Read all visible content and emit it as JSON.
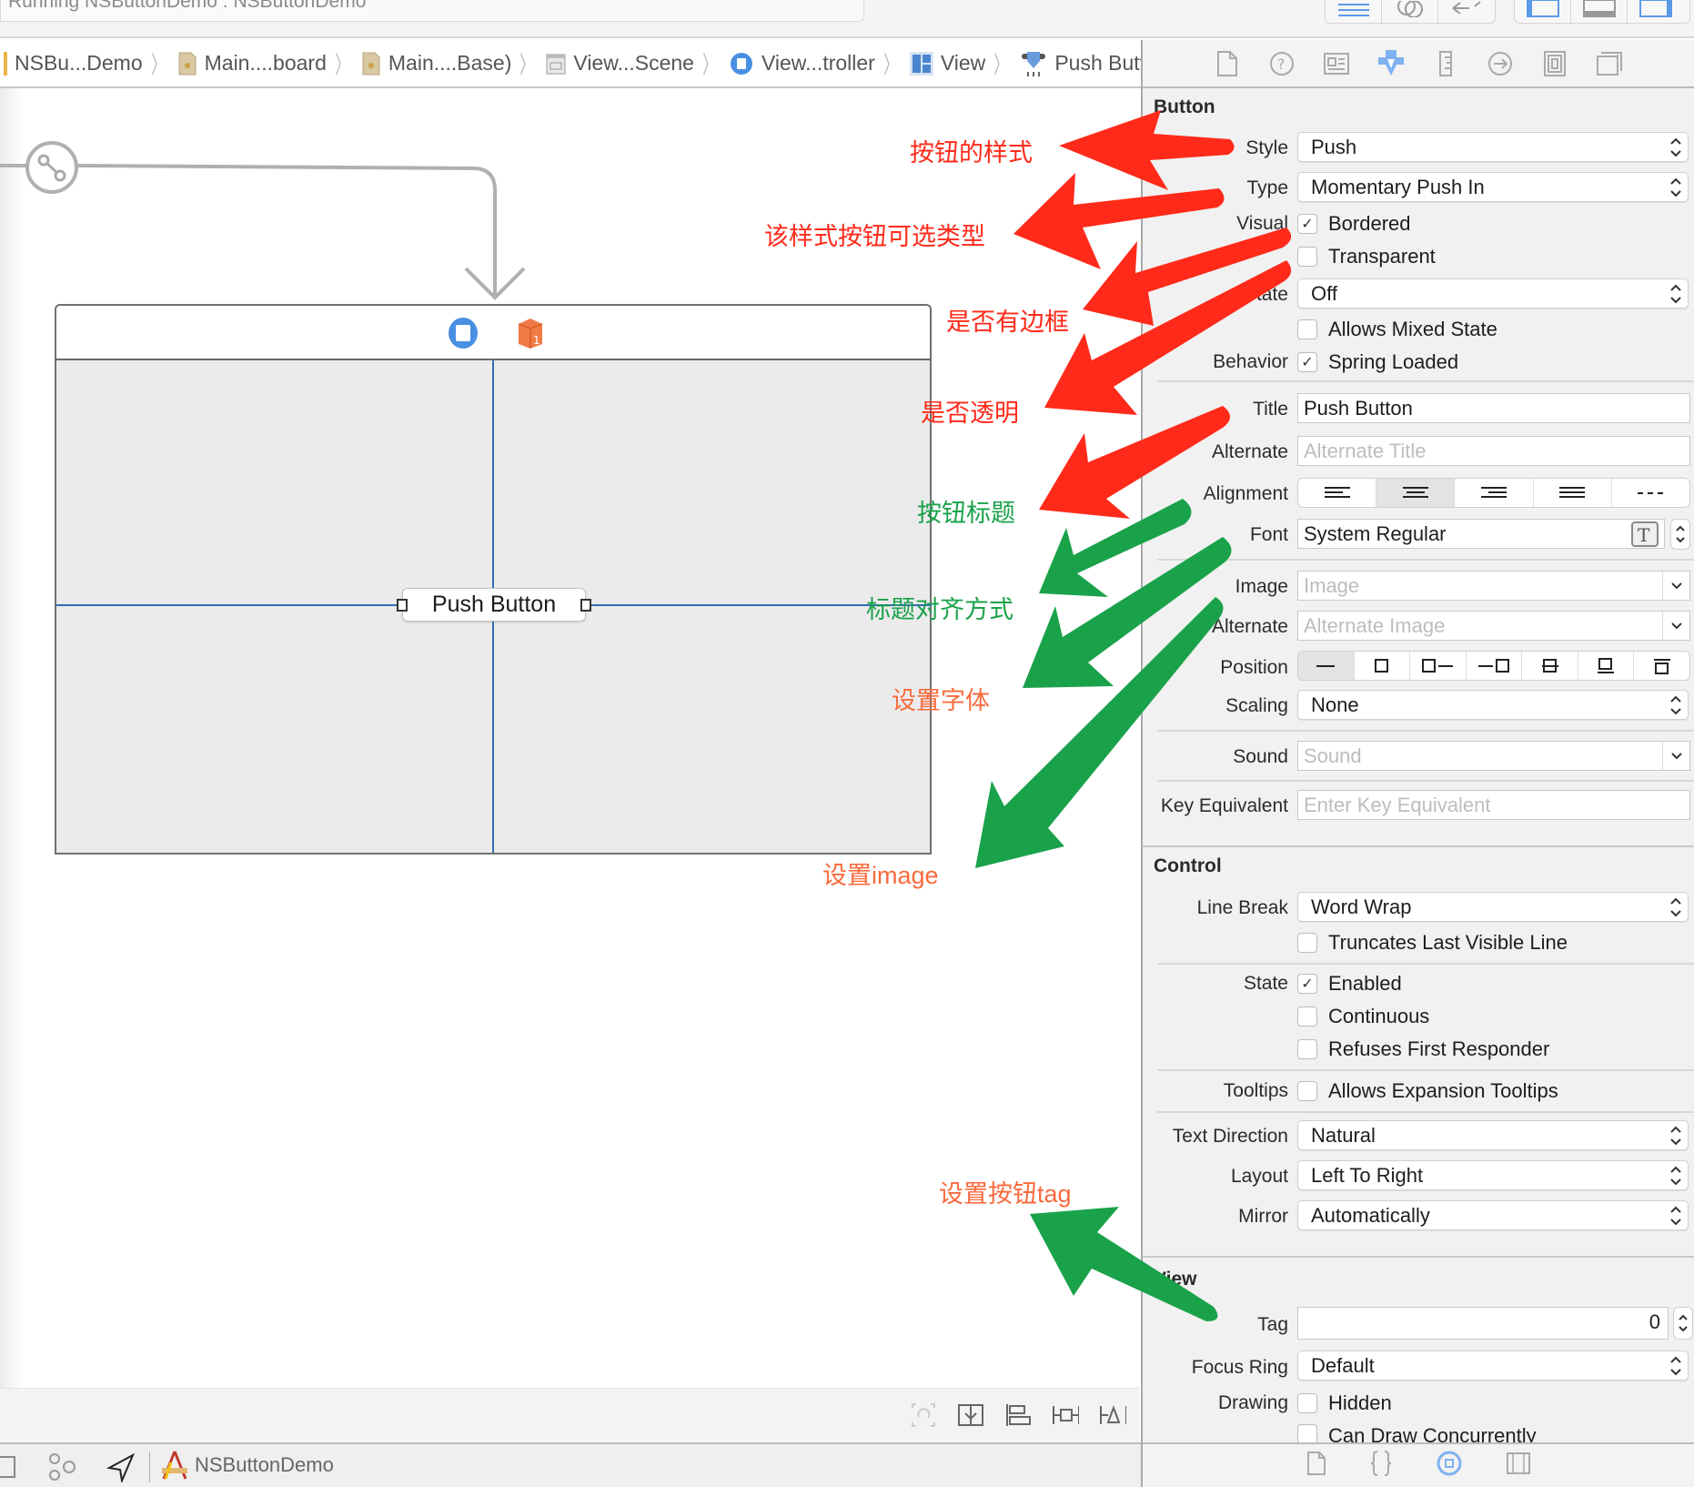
{
  "toolbar": {
    "run_status": "Running NSButtonDemo : NSButtonDemo",
    "editor_buttons": [
      "standard-editor-icon",
      "assistant-editor-icon",
      "version-editor-icon"
    ],
    "view_buttons": [
      "navigator-toggle-icon",
      "debug-area-toggle-icon",
      "utilities-toggle-icon"
    ]
  },
  "breadcrumb": [
    {
      "label": "NSBu...Demo",
      "icon": "project-icon"
    },
    {
      "label": "Main....board",
      "icon": "storyboard-file-icon"
    },
    {
      "label": "Main....Base)",
      "icon": "storyboard-file-icon"
    },
    {
      "label": "View...Scene",
      "icon": "scene-icon"
    },
    {
      "label": "View...troller",
      "icon": "view-controller-icon"
    },
    {
      "label": "View",
      "icon": "view-icon"
    },
    {
      "label": "Push Button",
      "icon": "push-button-icon"
    }
  ],
  "canvas": {
    "button_title": "Push Button",
    "scene_icons": [
      "view-controller-icon",
      "first-responder-icon"
    ],
    "bottom_tools": [
      "update-frames-icon",
      "embed-in-stack-icon",
      "align-icon",
      "pin-icon",
      "resolve-auto-layout-icon"
    ]
  },
  "debugbar": {
    "scheme_label": "NSButtonDemo",
    "icons": [
      "hide-debug-area-icon",
      "view-hierarchy-icon",
      "location-icon",
      "app-icon"
    ]
  },
  "inspector": {
    "tabs": [
      "file-inspector-icon",
      "quick-help-icon",
      "identity-inspector-icon",
      "attributes-inspector-icon",
      "size-inspector-icon",
      "connections-inspector-icon",
      "bindings-inspector-icon",
      "view-effects-inspector-icon"
    ],
    "active_tab": "attributes-inspector-icon",
    "button_section": {
      "title": "Button",
      "style_label": "Style",
      "style_value": "Push",
      "type_label": "Type",
      "type_value": "Momentary Push In",
      "visual_label": "Visual",
      "bordered_label": "Bordered",
      "bordered_checked": true,
      "transparent_label": "Transparent",
      "transparent_checked": false,
      "state_label": "State",
      "state_value": "Off",
      "mixed_state_label": "Allows Mixed State",
      "mixed_state_checked": false,
      "behavior_label": "Behavior",
      "spring_loaded_label": "Spring Loaded",
      "spring_loaded_checked": true,
      "title_label": "Title",
      "title_value": "Push Button",
      "alternate_label": "Alternate",
      "alternate_placeholder": "Alternate Title",
      "alignment_label": "Alignment",
      "alignment_options": [
        "left",
        "center",
        "right",
        "justified",
        "natural"
      ],
      "alignment_selected": "center",
      "font_label": "Font",
      "font_value": "System Regular",
      "image_label": "Image",
      "image_placeholder": "Image",
      "alt_image_label": "Alternate",
      "alt_image_placeholder": "Alternate Image",
      "position_label": "Position",
      "position_options": [
        "no-image",
        "image-only",
        "image-left",
        "image-right",
        "image-overlaps",
        "image-below",
        "image-above"
      ],
      "position_selected": "no-image",
      "scaling_label": "Scaling",
      "scaling_value": "None",
      "sound_label": "Sound",
      "sound_placeholder": "Sound",
      "key_equiv_label": "Key Equivalent",
      "key_equiv_placeholder": "Enter Key Equivalent"
    },
    "control_section": {
      "title": "Control",
      "line_break_label": "Line Break",
      "line_break_value": "Word Wrap",
      "truncates_label": "Truncates Last Visible Line",
      "truncates_checked": false,
      "state_label": "State",
      "enabled_label": "Enabled",
      "enabled_checked": true,
      "continuous_label": "Continuous",
      "continuous_checked": false,
      "refuses_label": "Refuses First Responder",
      "refuses_checked": false,
      "tooltips_label": "Tooltips",
      "expansion_label": "Allows Expansion Tooltips",
      "expansion_checked": false,
      "text_direction_label": "Text Direction",
      "text_direction_value": "Natural",
      "layout_label": "Layout",
      "layout_value": "Left To Right",
      "mirror_label": "Mirror",
      "mirror_value": "Automatically"
    },
    "view_section": {
      "title": "View",
      "tag_label": "Tag",
      "tag_value": "0",
      "focus_ring_label": "Focus Ring",
      "focus_ring_value": "Default",
      "drawing_label": "Drawing",
      "hidden_label": "Hidden",
      "hidden_checked": false,
      "concurrent_label": "Can Draw Concurrently",
      "concurrent_checked": false
    },
    "library_tabs": [
      "file-template-library-icon",
      "code-snippet-library-icon",
      "object-library-icon",
      "media-library-icon"
    ],
    "library_active": "object-library-icon"
  },
  "annotations": [
    {
      "text": "按钮的样式",
      "color": "red",
      "target": "Style"
    },
    {
      "text": "该样式按钮可选类型",
      "color": "red",
      "target": "Type"
    },
    {
      "text": "是否有边框",
      "color": "red",
      "target": "Bordered"
    },
    {
      "text": "是否透明",
      "color": "red",
      "target": "Transparent"
    },
    {
      "text": "按钮标题",
      "color": "green",
      "target": "Title"
    },
    {
      "text": "标题对齐方式",
      "color": "green",
      "target": "Alignment"
    },
    {
      "text": "设置字体",
      "color": "orange",
      "target": "Font"
    },
    {
      "text": "设置image",
      "color": "orange",
      "target": "Image"
    },
    {
      "text": "设置按钮tag",
      "color": "orange",
      "target": "Tag"
    }
  ],
  "colors": {
    "accent_blue": "#4a90e2",
    "annotation_red": "#ff2a1a",
    "annotation_green": "#1aa24a",
    "annotation_orange": "#f96a3c"
  }
}
